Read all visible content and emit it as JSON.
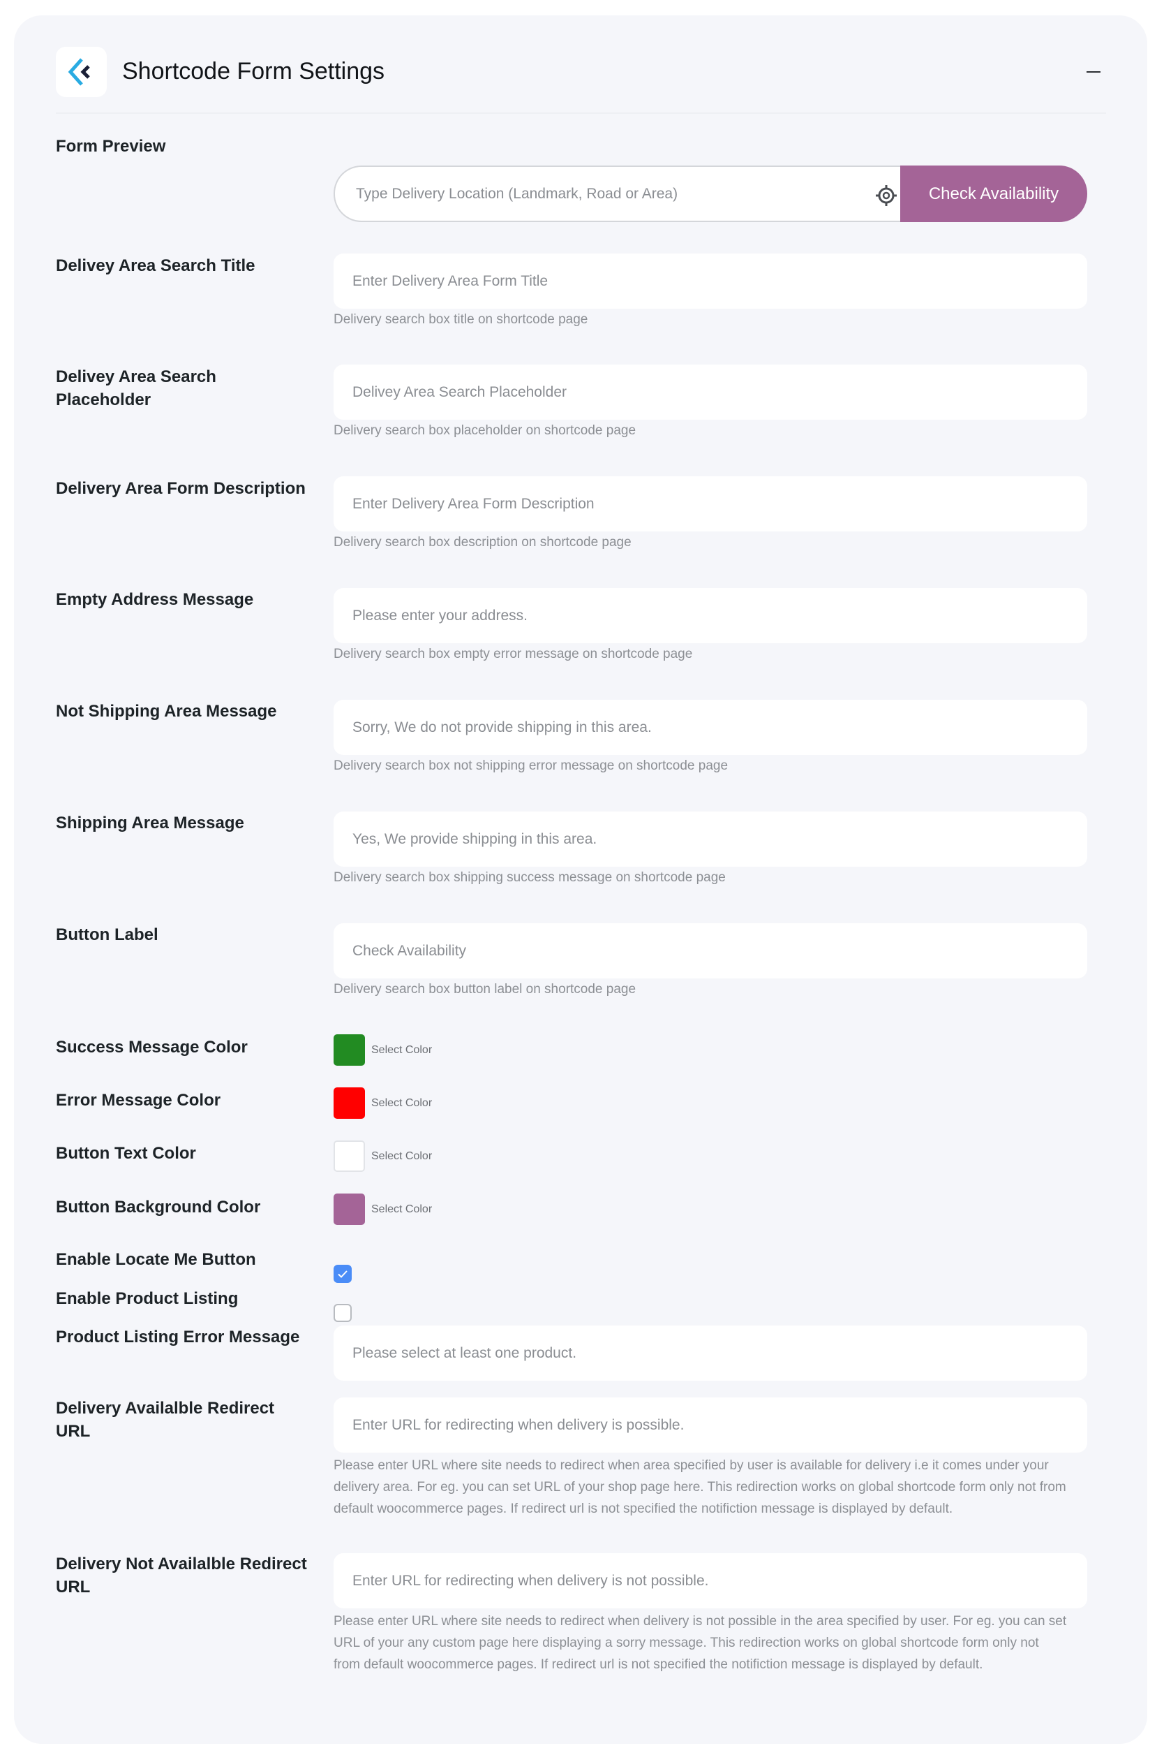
{
  "header": {
    "title": "Shortcode Form Settings",
    "logo_icon": "plugin-logo-icon",
    "collapse_icon": "minus-icon"
  },
  "preview": {
    "label": "Form Preview",
    "input_placeholder": "Type Delivery Location (Landmark, Road or Area)",
    "locate_icon": "crosshair-locate-icon",
    "button_label": "Check Availability",
    "button_color": "#a46497",
    "button_text_color": "#ffffff"
  },
  "fields": [
    {
      "label": "Delivey Area Search Title",
      "placeholder": "Enter Delivery Area Form Title",
      "value": "",
      "help": "Delivery search box title on shortcode page"
    },
    {
      "label": "Delivey Area Search Placeholder",
      "placeholder": "Delivey Area Search Placeholder",
      "value": "",
      "help": "Delivery search box placeholder on shortcode page"
    },
    {
      "label": "Delivery Area Form Description",
      "placeholder": "Enter Delivery Area Form Description",
      "value": "",
      "help": "Delivery search box description on shortcode page"
    },
    {
      "label": "Empty Address Message",
      "placeholder": "",
      "value": "Please enter your address.",
      "help": "Delivery search box empty error message on shortcode page"
    },
    {
      "label": "Not Shipping Area Message",
      "placeholder": "",
      "value": "Sorry, We do not provide shipping in this area.",
      "help": "Delivery search box not shipping error message on shortcode page"
    },
    {
      "label": "Shipping Area Message",
      "placeholder": "",
      "value": "Yes, We provide shipping in this area.",
      "help": "Delivery search box shipping success message on shortcode page"
    },
    {
      "label": "Button Label",
      "placeholder": "",
      "value": "Check Availability",
      "help": "Delivery search box button label on shortcode page"
    }
  ],
  "colors": [
    {
      "label": "Success Message Color",
      "value": "#228b22",
      "button_label": "Select Color"
    },
    {
      "label": "Error Message Color",
      "value": "#ff0000",
      "button_label": "Select Color"
    },
    {
      "label": "Button Text Color",
      "value": "#ffffff",
      "button_label": "Select Color"
    },
    {
      "label": "Button Background Color",
      "value": "#a46497",
      "button_label": "Select Color"
    }
  ],
  "toggles": [
    {
      "label": "Enable Locate Me Button",
      "checked": true
    },
    {
      "label": "Enable Product Listing",
      "checked": false
    }
  ],
  "product_listing_error": {
    "label": "Product Listing Error Message",
    "value": "Please select at least one product."
  },
  "redirects": [
    {
      "label": "Delivery Availalble Redirect URL",
      "placeholder": "Enter URL for redirecting when delivery is possible.",
      "help_lines": [
        "Please enter URL where site needs to redirect when area specified by user is available for delivery i.e it comes under your",
        "delivery area. For eg. you can set URL of your shop page here. This redirection works on global shortcode form only not from",
        "default woocommerce pages. If redirect url is not specified the notifiction message is displayed by default."
      ]
    },
    {
      "label": "Delivery Not Availalble Redirect URL",
      "placeholder": "Enter URL for redirecting when delivery is not possible.",
      "help_lines": [
        "Please enter URL where site needs to redirect when delivery is not possible in the area specified by user. For eg. you can set",
        "URL of your any custom page here displaying a sorry message. This redirection works on global shortcode form only not",
        "from default woocommerce pages. If redirect url is not specified the notifiction message is displayed by default."
      ]
    }
  ],
  "checkbox_color": "#4a8cf7"
}
